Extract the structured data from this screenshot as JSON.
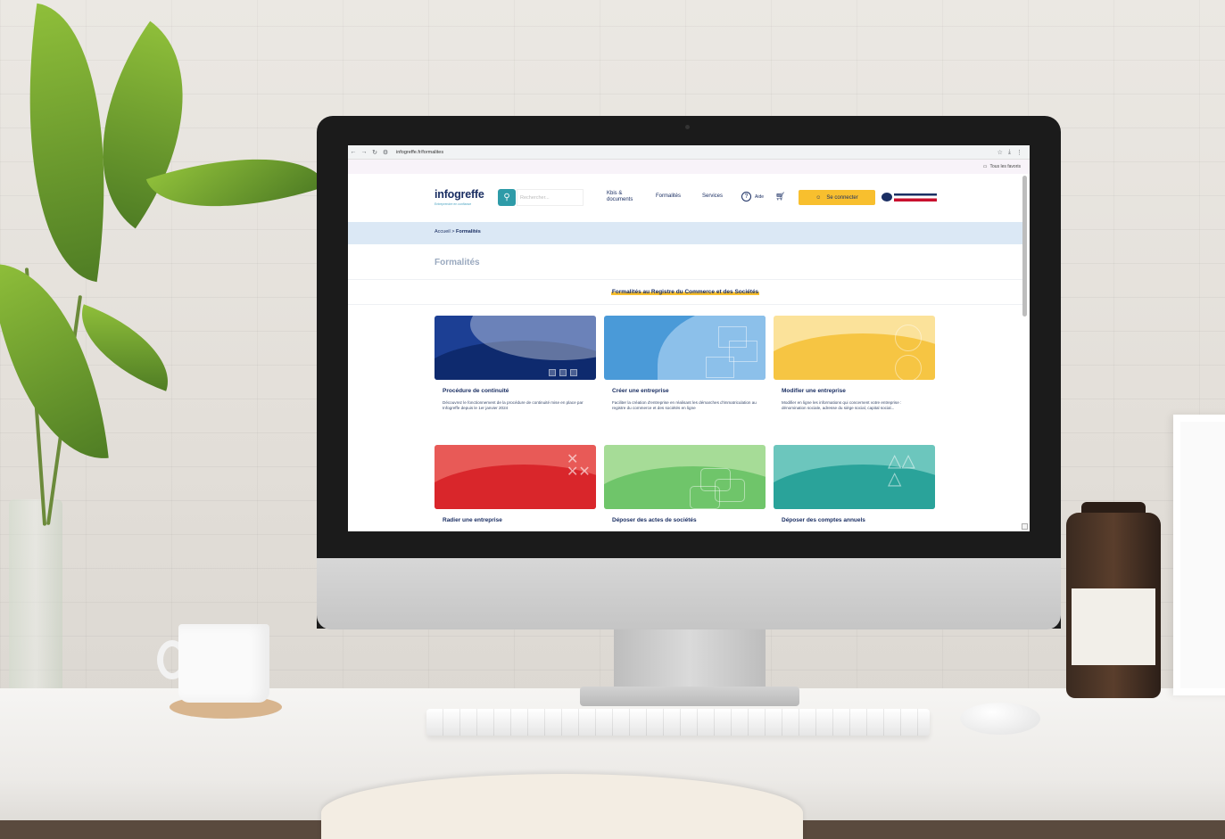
{
  "browser": {
    "url": "infogreffe.fr/formalites",
    "bookmarks_label": "Tous les favoris"
  },
  "header": {
    "logo_text": "infogreffe",
    "logo_tagline": "Entreprendre en confiance",
    "search_placeholder": "Rechercher...",
    "nav": {
      "kbis_line1": "Kbis &",
      "kbis_line2": "documents",
      "formalites": "Formalités",
      "services": "Services",
      "aide": "Aide"
    },
    "login_label": "Se connecter"
  },
  "breadcrumb": {
    "home": "Accueil",
    "separator": ">",
    "current": "Formalités"
  },
  "page": {
    "title": "Formalités",
    "section_heading": "Formalités au Registre du Commerce et des Sociétés"
  },
  "cards": [
    {
      "title": "Procédure de continuité",
      "description": "Découvrez le fonctionnement de la procédure de continuité mise en place par Infogreffe depuis le 1er janvier 2024",
      "color": "#1c3f94",
      "accent": "#0e2a6e"
    },
    {
      "title": "Créer une entreprise",
      "description": "Faciliter la création d'entreprise en réalisant les démarches d'immatriculation au registre du commerce et des sociétés en ligne",
      "color": "#4a9ad8",
      "accent": "#8cc0ea"
    },
    {
      "title": "Modifier une entreprise",
      "description": "Modifier en ligne les informations qui concernent votre entreprise : dénomination sociale, adresse du siège social, capital social...",
      "color": "#f6c543",
      "accent": "#fbe29a"
    },
    {
      "title": "Radier une entreprise",
      "description": "",
      "color": "#d9262b",
      "accent": "#e85a57"
    },
    {
      "title": "Déposer des actes de sociétés",
      "description": "",
      "color": "#6fc56a",
      "accent": "#a6dc97"
    },
    {
      "title": "Déposer des comptes annuels",
      "description": "",
      "color": "#2aa39a",
      "accent": "#6cc6bd"
    }
  ]
}
